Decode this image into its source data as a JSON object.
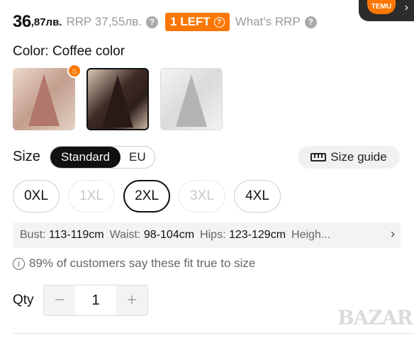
{
  "price": {
    "main": "36",
    "decimal": ",87лв.",
    "rrp": "RRP 37,55лв.",
    "left_badge": "1 LEFT",
    "whats_rrp": "What's RRP"
  },
  "temu": {
    "logo": "TEMU"
  },
  "color": {
    "label": "Color: Coffee color"
  },
  "size": {
    "label": "Size",
    "toggle": [
      "Standard",
      "EU"
    ],
    "guide": "Size guide",
    "options": [
      {
        "label": "0XL",
        "state": "available"
      },
      {
        "label": "1XL",
        "state": "unavailable"
      },
      {
        "label": "2XL",
        "state": "selected"
      },
      {
        "label": "3XL",
        "state": "unavailable"
      },
      {
        "label": "4XL",
        "state": "available"
      }
    ],
    "measurements": {
      "bust_label": "Bust:",
      "bust": "113-119cm",
      "waist_label": "Waist:",
      "waist": "98-104cm",
      "hips_label": "Hips:",
      "hips": "123-129cm",
      "height_label": "Heigh..."
    },
    "fit_text": "89% of customers say these fit true to size"
  },
  "qty": {
    "label": "Qty",
    "value": "1",
    "minus": "−",
    "plus": "+"
  },
  "watermark": "BAZAR",
  "colors": {
    "accent": "#fb7701"
  }
}
